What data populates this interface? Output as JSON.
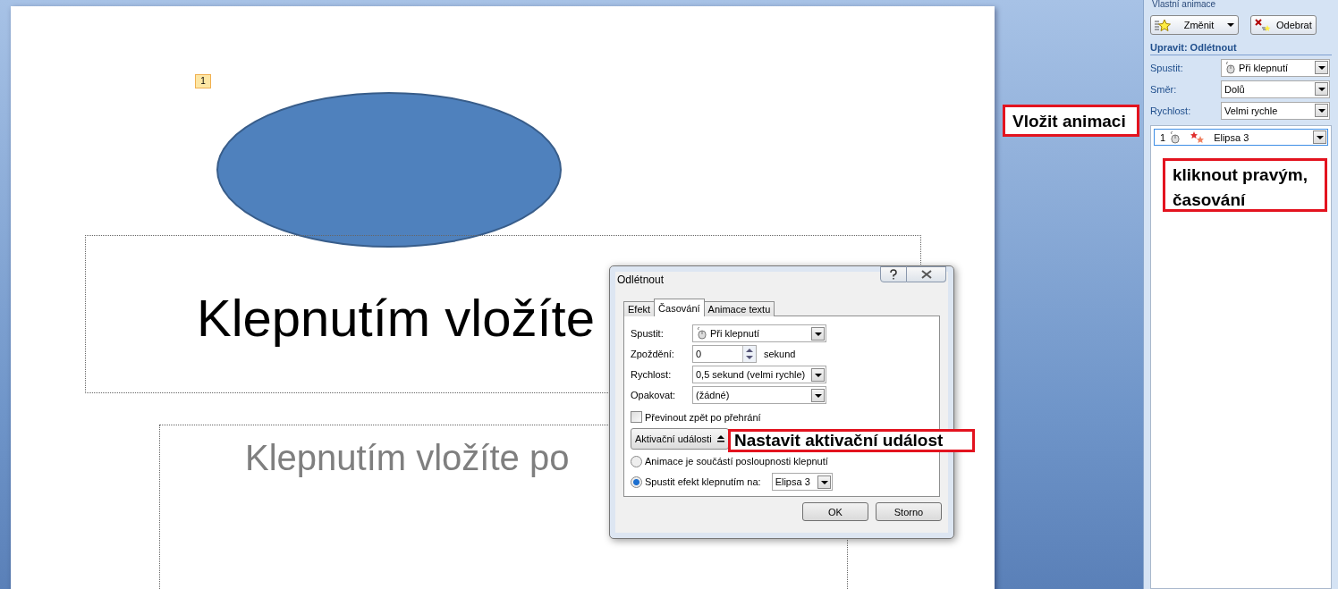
{
  "slide": {
    "badge": "1",
    "title_placeholder": "Klepnutím vložíte",
    "subtitle_placeholder": "Klepnutím vložíte po"
  },
  "dialog": {
    "title": "Odlétnout",
    "tabs": [
      {
        "label": "Efekt",
        "selected": false
      },
      {
        "label": "Časování",
        "selected": true
      },
      {
        "label": "Animace textu",
        "selected": false
      }
    ],
    "fields": [
      {
        "label": "Spustit:",
        "value": "Při klepnutí",
        "kind": "trigger"
      },
      {
        "label": "Zpoždění:",
        "value": "0",
        "kind": "spinner",
        "unit": "sekund"
      },
      {
        "label": "Rychlost:",
        "value": "0,5 sekund (velmi rychle)",
        "kind": "dropdown"
      },
      {
        "label": "Opakovat:",
        "value": "(žádné)",
        "kind": "dropdown"
      }
    ],
    "checkbox": {
      "label": "Převinout zpět po přehrání",
      "checked": false
    },
    "triggers_button": "Aktivační události",
    "radios": [
      {
        "label": "Animace je součástí posloupnosti klepnutí",
        "selected": false
      },
      {
        "label": "Spustit efekt klepnutím na:",
        "selected": true,
        "dropdown": "Elipsa 3"
      }
    ],
    "buttons": [
      "OK",
      "Storno"
    ]
  },
  "panel": {
    "title": "Vlastní animace",
    "buttons": [
      {
        "label": "Změnit",
        "kind": "change"
      },
      {
        "label": "Odebrat",
        "kind": "remove"
      }
    ],
    "heading": "Upravit: Odlétnout",
    "fields": [
      {
        "label": "Spustit:",
        "value": "Při klepnutí",
        "kind": "trigger"
      },
      {
        "label": "Směr:",
        "value": "Dolů",
        "kind": "dropdown"
      },
      {
        "label": "Rychlost:",
        "value": "Velmi rychle",
        "kind": "dropdown"
      }
    ],
    "list": [
      {
        "number": "1",
        "name": "Elipsa 3",
        "selected": true
      }
    ]
  },
  "annotations": [
    {
      "text": "Vložit animaci"
    },
    {
      "text": "kliknout pravým, časování"
    },
    {
      "text": "Nastavit aktivační událost"
    }
  ]
}
